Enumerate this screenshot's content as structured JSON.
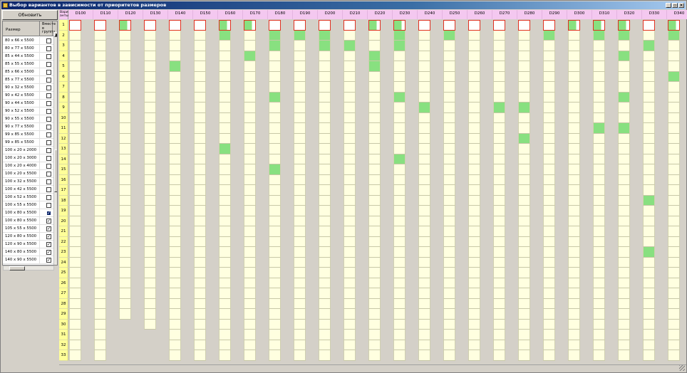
{
  "window": {
    "title": "Выбор вариантов в зависимости от приоритетов размеров",
    "minimize": "_",
    "restore": "▫",
    "close": "×"
  },
  "left": {
    "refresh_label": "Обновить",
    "col_size": "Размер",
    "col_include": "Вместе в группу",
    "rows": [
      {
        "size": "80 x 66 x 5500",
        "checked": false
      },
      {
        "size": "80 x 77 x 5500",
        "checked": false
      },
      {
        "size": "85 x 44 x 5500",
        "checked": false
      },
      {
        "size": "85 x 55 x 5500",
        "checked": false
      },
      {
        "size": "85 x 66 x 5500",
        "checked": false
      },
      {
        "size": "85 x 77 x 5500",
        "checked": false
      },
      {
        "size": "90 x 32 x 5500",
        "checked": false
      },
      {
        "size": "90 x 42 x 5500",
        "checked": false
      },
      {
        "size": "90 x 44 x 5500",
        "checked": false
      },
      {
        "size": "90 x 52 x 5500",
        "checked": false
      },
      {
        "size": "90 x 55 x 5500",
        "checked": false
      },
      {
        "size": "90 x 77 x 5500",
        "checked": false
      },
      {
        "size": "99 x 85 x 5500",
        "checked": false
      },
      {
        "size": "99 x 85 x 5500",
        "checked": false
      },
      {
        "size": "100 x 20 x 2000",
        "checked": false
      },
      {
        "size": "100 x 20 x 3000",
        "checked": false
      },
      {
        "size": "100 x 20 x 4000",
        "checked": false
      },
      {
        "size": "100 x 20 x 5500",
        "checked": false
      },
      {
        "size": "100 x 32 x 5500",
        "checked": false
      },
      {
        "size": "100 x 42 x 5500",
        "checked": false
      },
      {
        "size": "100 x 52 x 5500",
        "checked": false
      },
      {
        "size": "100 x 55 x 5500",
        "checked": false
      },
      {
        "size": "100 x 80 x 5500",
        "checked": true,
        "selected": true
      },
      {
        "size": "100 x 80 x 5500",
        "checked": true
      },
      {
        "size": "105 x 55 x 5500",
        "checked": true
      },
      {
        "size": "120 x 80 x 5500",
        "checked": true
      },
      {
        "size": "120 x 90 x 5500",
        "checked": true
      },
      {
        "size": "140 x 80 x 5500",
        "checked": true
      },
      {
        "size": "140 x 90 x 5500",
        "checked": true
      }
    ]
  },
  "grid": {
    "corner_label": "Вари-анты:",
    "columns": [
      "D100",
      "D110",
      "D120",
      "D130",
      "D140",
      "D150",
      "D160",
      "D170",
      "D180",
      "D190",
      "D200",
      "D210",
      "D220",
      "D230",
      "D240",
      "D250",
      "D260",
      "D270",
      "D280",
      "D290",
      "D300",
      "D310",
      "D320",
      "D330",
      "D340"
    ],
    "row_counts": [
      33,
      33,
      29,
      30,
      33,
      33,
      33,
      33,
      33,
      33,
      33,
      33,
      33,
      33,
      33,
      33,
      33,
      33,
      33,
      33,
      33,
      33,
      33,
      33,
      33
    ],
    "row_labels": [
      "1",
      "2",
      "3",
      "4",
      "5",
      "6",
      "7",
      "8",
      "9",
      "10",
      "11",
      "12",
      "13",
      "14",
      "15",
      "16",
      "17",
      "18",
      "19",
      "20",
      "21",
      "22",
      "23",
      "24",
      "25",
      "26",
      "27",
      "28",
      "29",
      "30",
      "31",
      "32",
      "33"
    ],
    "first_row_green": [
      false,
      false,
      true,
      false,
      false,
      false,
      true,
      true,
      false,
      false,
      false,
      false,
      true,
      true,
      false,
      false,
      false,
      false,
      false,
      false,
      true,
      true,
      true,
      false,
      true
    ],
    "highlighted": [
      [
        6,
        2
      ],
      [
        8,
        2
      ],
      [
        9,
        2
      ],
      [
        10,
        2
      ],
      [
        13,
        2
      ],
      [
        15,
        2
      ],
      [
        19,
        2
      ],
      [
        21,
        2
      ],
      [
        22,
        2
      ],
      [
        24,
        2
      ],
      [
        8,
        3
      ],
      [
        10,
        3
      ],
      [
        11,
        3
      ],
      [
        13,
        3
      ],
      [
        23,
        3
      ],
      [
        7,
        4
      ],
      [
        12,
        4
      ],
      [
        22,
        4
      ],
      [
        4,
        5
      ],
      [
        12,
        5
      ],
      [
        24,
        6
      ],
      [
        8,
        8
      ],
      [
        13,
        8
      ],
      [
        22,
        8
      ],
      [
        14,
        9
      ],
      [
        17,
        9
      ],
      [
        18,
        9
      ],
      [
        21,
        11
      ],
      [
        22,
        11
      ],
      [
        18,
        12
      ],
      [
        6,
        13
      ],
      [
        13,
        14
      ],
      [
        8,
        15
      ],
      [
        23,
        18
      ],
      [
        23,
        23
      ]
    ],
    "colors": {
      "header": "#f4c8f0",
      "rowhead": "#ffff99",
      "cell": "#ffffe0",
      "green": "#88e080",
      "red": "#e03020"
    }
  }
}
